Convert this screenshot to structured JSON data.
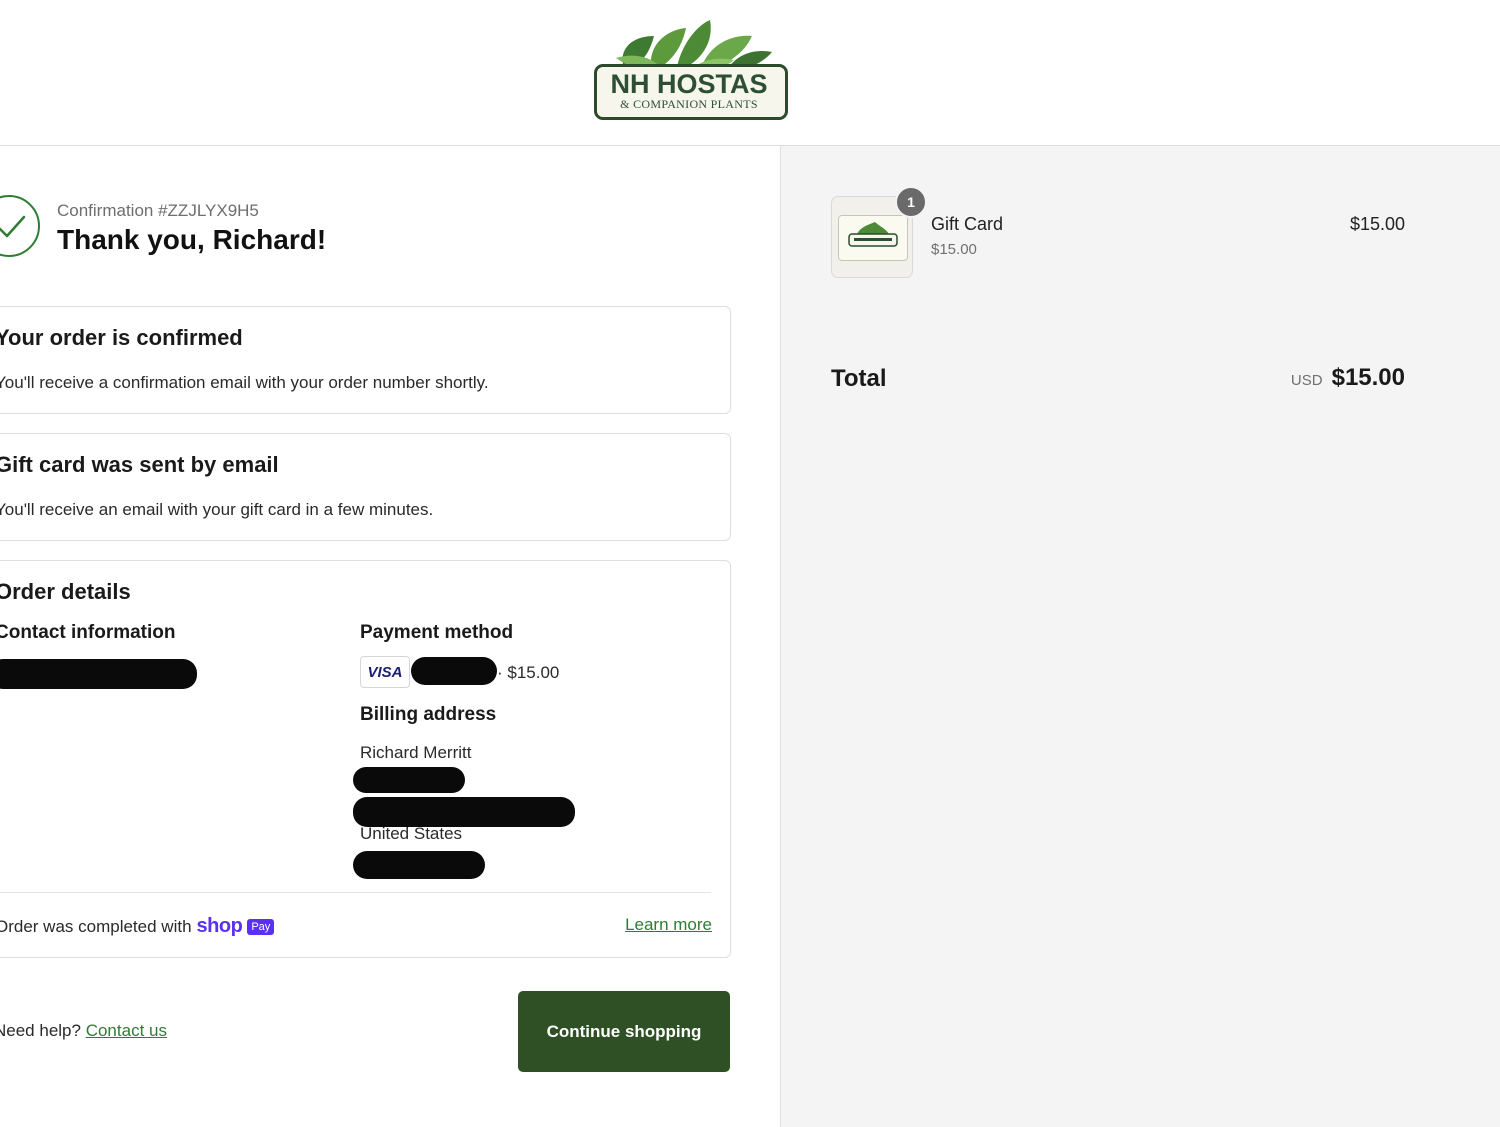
{
  "brand": {
    "name": "NH HOSTAS",
    "tagline": "& COMPANION PLANTS"
  },
  "colors": {
    "accent": "#2e7d32",
    "button_bg": "#2f4f24",
    "shop_pay": "#5a31f4",
    "summary_bg": "#f4f4f4"
  },
  "confirmation": {
    "number": "Confirmation #ZZJLYX9H5",
    "thank_you": "Thank you, Richard!"
  },
  "order_confirmed": {
    "title": "Your order is confirmed",
    "text": "You'll receive a confirmation email with your order number shortly."
  },
  "gift_card_sent": {
    "title": "Gift card was sent by email",
    "text": "You'll receive an email with your gift card in a few minutes."
  },
  "order_details": {
    "title": "Order details",
    "contact_heading": "Contact information",
    "payment_heading": "Payment method",
    "card_brand": "VISA",
    "payment_amount": "· $15.00",
    "billing_heading": "Billing address",
    "billing_name": "Richard Merritt",
    "billing_country": "United States",
    "shop_text": "Order was completed with",
    "shop_word": "shop",
    "shop_pay": "Pay",
    "learn_more": "Learn more"
  },
  "footer": {
    "help_text": "Need help?",
    "contact_link": "Contact us",
    "continue_button": "Continue shopping"
  },
  "summary": {
    "quantity_badge": "1",
    "item_name": "Gift Card",
    "item_variant": "$15.00",
    "item_price": "$15.00",
    "total_label": "Total",
    "currency": "USD",
    "total_amount": "$15.00"
  }
}
